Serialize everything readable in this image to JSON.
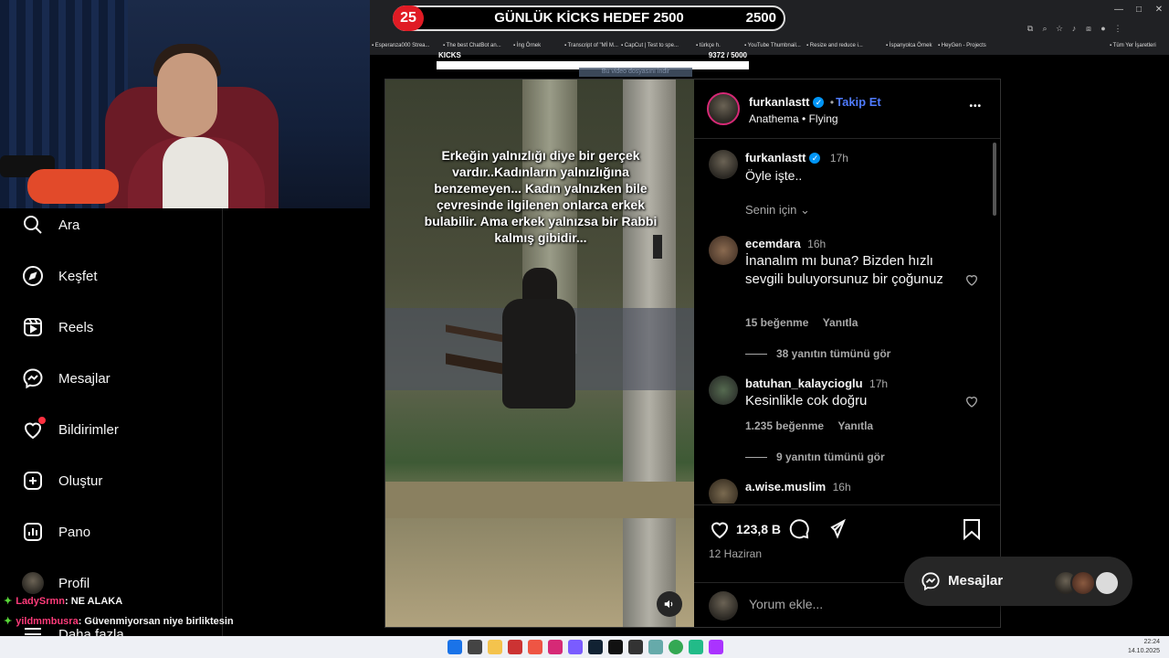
{
  "overlay": {
    "goal_count": "25",
    "goal_title": "GÜNLÜK KİCKS HEDEF 2500",
    "goal_target": "2500",
    "kicks_label": "KICKS",
    "kicks_count": "9372",
    "kicks_total": "/ 5000",
    "kicks_fill_fraction": 1.0
  },
  "browser": {
    "bookmarks": [
      "Esperanza000 Strea...",
      "The best ChatBot an...",
      "İng Örnek",
      "Transcript of \"Mİ M...",
      "CapCut | Test to spe...",
      "türkçe h.",
      "YouTube Thumbnail...",
      "Resize and reduce i...",
      "İspanyolca Örnek",
      "HeyGen - Projects",
      "Tüm Yer İşaretleri"
    ],
    "download_tip": "Bu video dosyasını indir"
  },
  "sidebar": {
    "items": [
      {
        "label": "Ara",
        "icon": "search-icon"
      },
      {
        "label": "Keşfet",
        "icon": "compass-icon"
      },
      {
        "label": "Reels",
        "icon": "reels-icon"
      },
      {
        "label": "Mesajlar",
        "icon": "messenger-icon"
      },
      {
        "label": "Bildirimler",
        "icon": "heart-icon"
      },
      {
        "label": "Oluştur",
        "icon": "plus-square-icon"
      },
      {
        "label": "Pano",
        "icon": "chart-icon"
      },
      {
        "label": "Profil",
        "icon": "avatar"
      },
      {
        "label": "Daha fazla",
        "icon": "menu-icon"
      }
    ]
  },
  "chat": [
    {
      "user": "LadySrmn",
      "text": ": NE ALAKA",
      "color": "#ff3b7a"
    },
    {
      "user": "yildmmbusra",
      "text": ": Güvenmiyorsan niye birliktesin",
      "color": "#ff3b7a"
    }
  ],
  "post": {
    "caption": "Erkeğin yalnızlığı diye bir gerçek vardır..Kadınların yalnızlığına benzemeyen... Kadın yalnızken bile çevresinde ilgilenen onlarca erkek bulabilir. Ama erkek yalnızsa bir Rabbi kalmış gibidir...",
    "author": "furkanlastt",
    "follow": "Takip Et",
    "dot": "•",
    "audio_artist": "Anathema",
    "audio_song": "Flying",
    "more": "•••",
    "caption_comment": {
      "user": "furkanlastt",
      "time": "17h",
      "text": "Öyle işte.."
    },
    "for_you": "Senin için",
    "comments": [
      {
        "user": "ecemdara",
        "time": "16h",
        "text": "İnanalım mı buna? Bizden hızlı sevgili buluyorsunuz bir çoğunuz",
        "likes": "15 beğenme",
        "reply": "Yanıtla",
        "replies": "38 yanıtın tümünü gör"
      },
      {
        "user": "batuhan_kalaycioglu",
        "time": "17h",
        "text": "Kesinlikle cok doğru",
        "likes": "1.235 beğenme",
        "reply": "Yanıtla",
        "replies": "9 yanıtın tümünü gör"
      },
      {
        "user": "a.wise.muslim",
        "time": "16h",
        "text": ""
      }
    ],
    "like_count": "123,8 B",
    "date": "12 Haziran",
    "add_comment_placeholder": "Yorum ekle..."
  },
  "messages_pill": {
    "label": "Mesajlar"
  },
  "taskbar": {
    "time": "22:24",
    "date": "14.10.2025"
  }
}
